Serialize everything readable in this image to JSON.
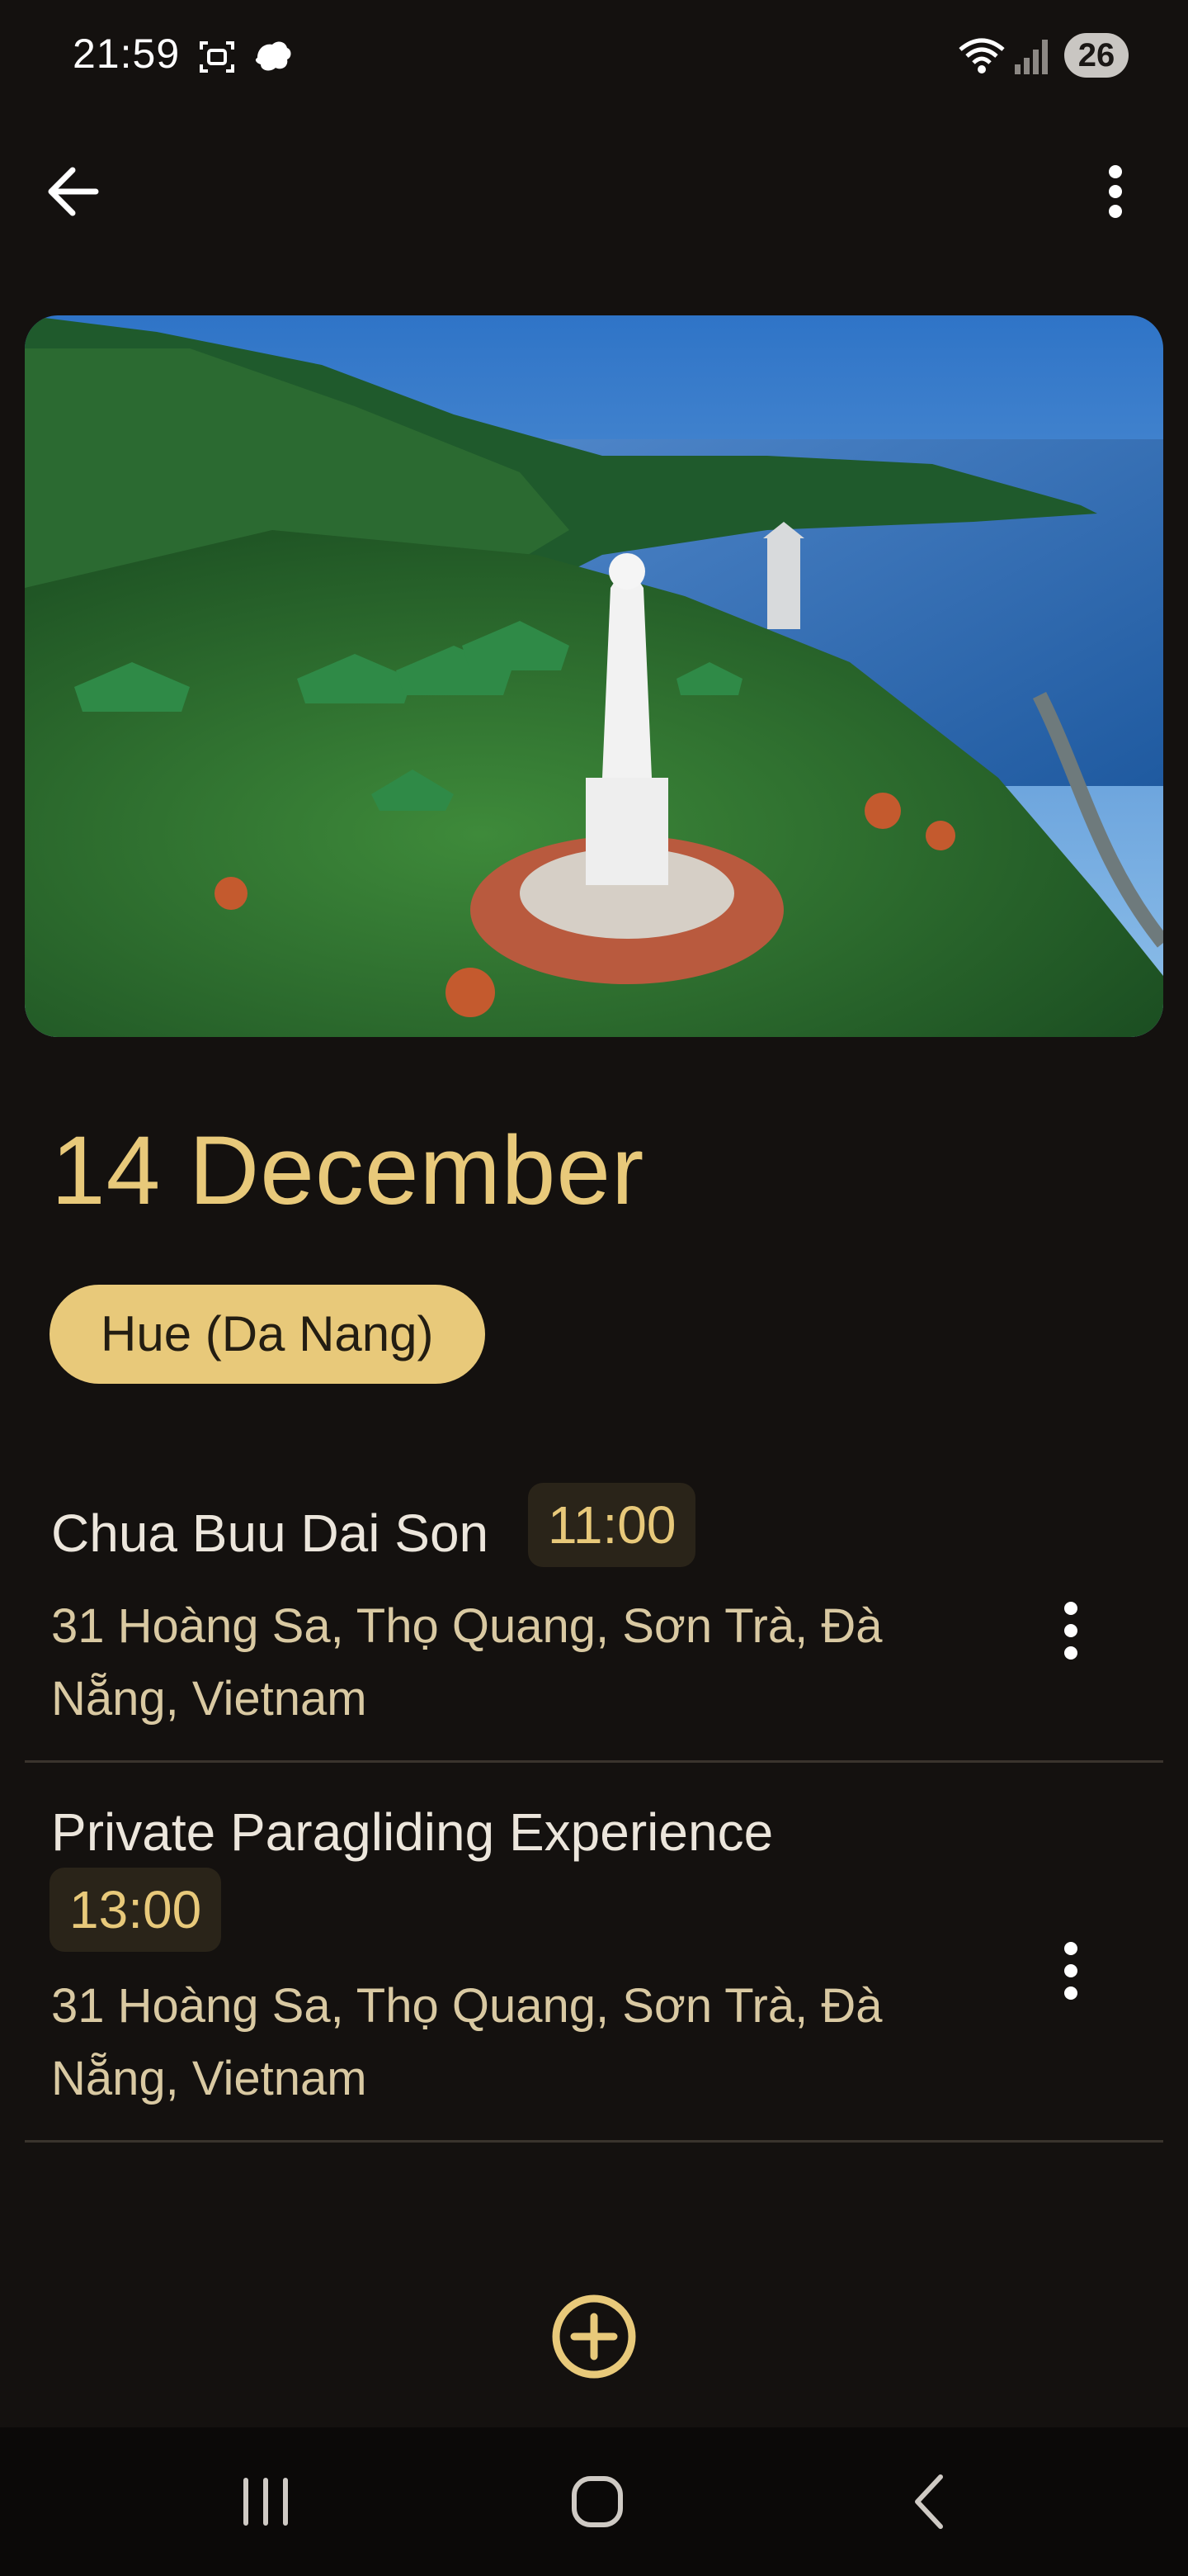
{
  "status_bar": {
    "time": "21:59",
    "battery": "26",
    "icons": [
      "screenshot-icon",
      "notification-icon",
      "wifi-icon",
      "signal-icon"
    ]
  },
  "app_bar": {
    "back_icon": "arrow-left-icon",
    "more_icon": "more-vertical-icon"
  },
  "trip_day": {
    "date": "14 December",
    "location_chip": "Hue (Da Nang)"
  },
  "activities": [
    {
      "title": "Chua Buu Dai Son",
      "time": "11:00",
      "address": "31 Hoàng Sa, Thọ Quang, Sơn Trà, Đà Nẵng, Vietnam"
    },
    {
      "title": "Private Paragliding Experience",
      "time": "13:00",
      "address": "31 Hoàng Sa, Thọ Quang, Sơn Trà, Đà Nẵng, Vietnam"
    }
  ],
  "add_icon": "plus-circle-icon",
  "colors": {
    "background": "#14110f",
    "accent": "#e8c97a",
    "badge_bg": "#2a2419",
    "text": "#ece6dc",
    "address_text": "#d9c9a2"
  },
  "nav_bar": {
    "icons": [
      "recents-icon",
      "home-icon",
      "back-icon"
    ]
  }
}
